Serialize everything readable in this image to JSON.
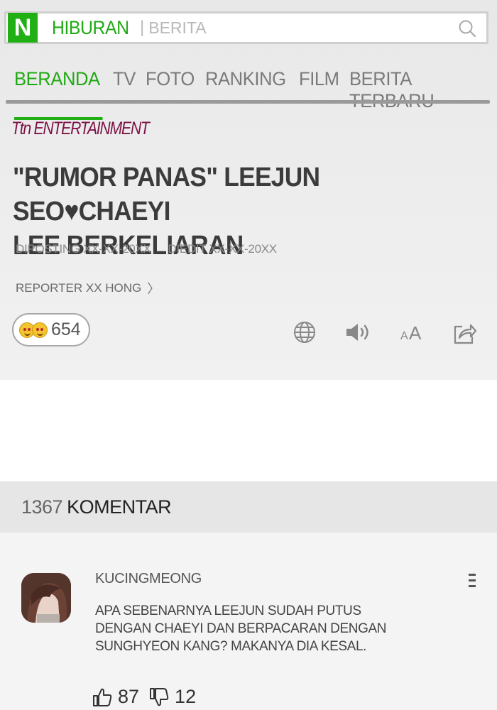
{
  "search": {
    "logo": "N",
    "brand": "HIBURAN",
    "separator": "|",
    "section": "BERITA"
  },
  "nav": {
    "tabs": [
      "BERANDA",
      "TV",
      "FOTO",
      "RANKING",
      "FILM",
      "BERITA TERBARU"
    ],
    "active": "BERANDA"
  },
  "article": {
    "outlet": "Ttn ENTERTAINMENT",
    "headline_line1": "\"RUMOR PANAS\" LEEJUN SEO♥CHAEYI",
    "headline_line2": "LEE BERKELIARAN",
    "posted": "DIPOSTING XX-XX-20XX",
    "edited": "DIEDIT XX-XX-20XX",
    "reporter": "REPORTER XX HONG",
    "reaction_count": "654",
    "icons": [
      "globe-icon",
      "speaker-icon",
      "font-size-icon",
      "share-icon"
    ]
  },
  "comments_section": {
    "count": "1367",
    "label": "KOMENTAR"
  },
  "comment": {
    "username": "KUCINGMEONG",
    "line1": "APA SEBENARNYA LEEJUN SUDAH PUTUS",
    "line2": "DENGAN CHAEYI DAN BERPACARAN DENGAN",
    "line3": "SUNGHYEON KANG?  MAKANYA DIA KESAL.",
    "likes": "87",
    "dislikes": "12"
  },
  "colors": {
    "accent": "#21b014",
    "outlet": "#7b1346"
  }
}
